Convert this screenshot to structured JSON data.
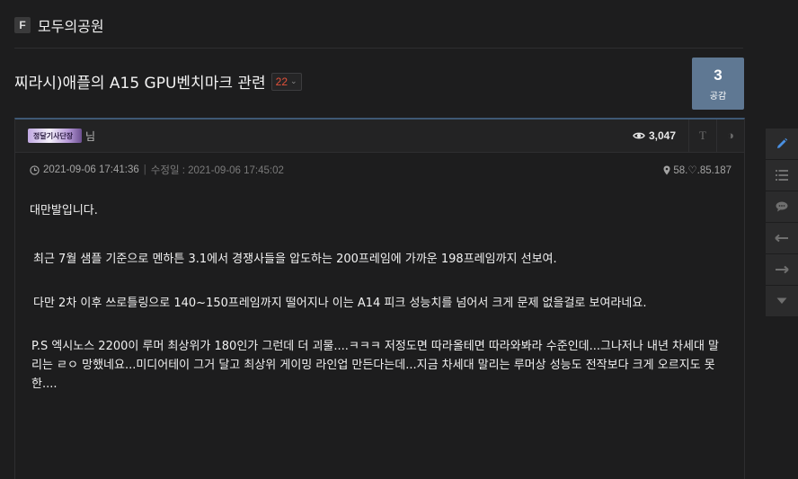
{
  "board": {
    "badge": "F",
    "name": "모두의공원"
  },
  "post": {
    "title": "찌라시)애플의 A15 GPU벤치마크 관련",
    "comment_count": "22",
    "like_count": "3",
    "like_label": "공감",
    "author_nick": "정달기사단장",
    "author_suffix": "님",
    "views": "3,047",
    "created": "2021-09-06 17:41:36",
    "edited_label": "수정일 : 2021-09-06 17:45:02",
    "ip": "58.♡.85.187",
    "paragraphs": [
      "대만발입니다.",
      "최근 7월 샘플 기준으로 멘하튼 3.1에서 경쟁사들을 압도하는 200프레임에 가까운 198프레임까지 선보여.",
      "다만 2차 이후 쓰로틀링으로 140~150프레임까지 떨어지나 이는 A14 피크 성능치를 넘어서 크게 문제 없을걸로 보여라네요.",
      "P.S 엑시노스 2200이 루머 최상위가 180인가 그런데 더 괴물....ㅋㅋㅋ 저정도면 따라올테면 따라와봐라 수준인데...그나저나 내년 차세대 말리는 ㄹㅇ 망했네요...미디어테이 그거 달고 최상위 게이밍 라인업 만든다는데...지금 차세대 말리는 루머상 성능도 전작보다 크게 오르지도 못한...."
    ]
  },
  "toolbar": {
    "font_icon_text": "T",
    "theme_icon": "◑"
  },
  "side_tools": [
    "pencil-icon",
    "list-icon",
    "comment-icon",
    "arrow-left-icon",
    "arrow-right-icon",
    "caret-down-icon"
  ],
  "colors": {
    "accent": "#4a90e2",
    "like_box": "#5f7893",
    "comment_count": "#e2513a",
    "card_border": "#3e5874"
  }
}
